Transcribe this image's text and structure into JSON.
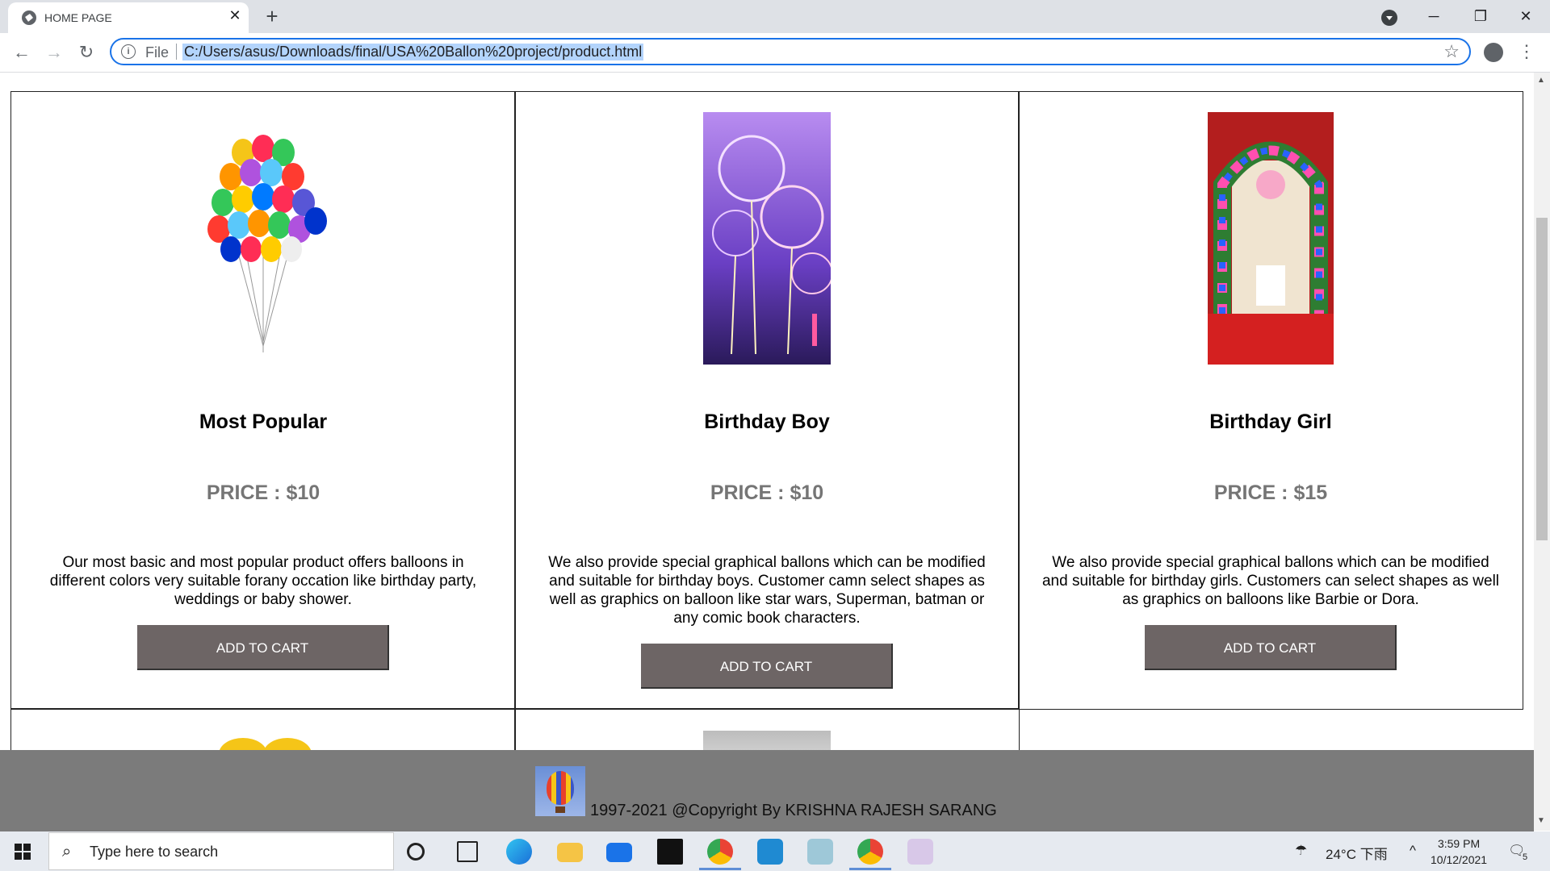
{
  "browser": {
    "tab_title": "HOME PAGE",
    "tab_close": "✕",
    "new_tab": "+",
    "file_label": "File",
    "url": "C:/Users/asus/Downloads/final/USA%20Ballon%20project/product.html",
    "win_min": "─",
    "win_max": "❐",
    "win_close": "✕"
  },
  "products": [
    {
      "title": "Most Popular",
      "price": "PRICE : $10",
      "description": "Our most basic and most popular product offers balloons in different colors very suitable forany occation like birthday party, weddings or baby shower.",
      "button": "ADD TO CART",
      "image_icon": "balloon-bunch-image"
    },
    {
      "title": "Birthday Boy",
      "price": "PRICE : $10",
      "description": "We also provide special graphical ballons which can be modified and suitable for birthday boys. Customer camn select shapes as well as graphics on balloon like star wars, Superman, batman or any comic book characters.",
      "button": "ADD TO CART",
      "image_icon": "led-balloons-image"
    },
    {
      "title": "Birthday Girl",
      "price": "PRICE : $15",
      "description": "We also provide special graphical ballons which can be modified and suitable for birthday girls. Customers can select shapes as well as graphics on balloons like Barbie or Dora.",
      "button": "ADD TO CART",
      "image_icon": "balloon-arch-image"
    }
  ],
  "footer": {
    "copyright": "1997-2021 @Copyright By KRISHNA RAJESH SARANG"
  },
  "taskbar": {
    "search_placeholder": "Type here to search",
    "weather": "24°C 下雨",
    "time": "3:59 PM",
    "date": "10/12/2021",
    "notifications": "5"
  },
  "colors": {
    "button_bg": "#6d6565",
    "price_text": "#757575",
    "footer_bg": "#7b7b7b",
    "omnibox_border": "#1a73e8"
  }
}
